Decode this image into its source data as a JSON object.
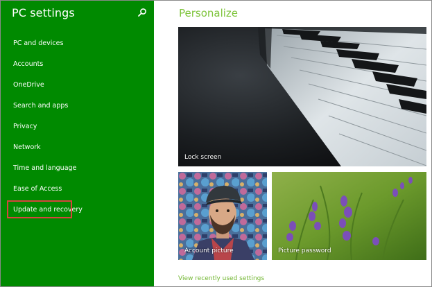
{
  "sidebar": {
    "title": "PC settings",
    "search_icon": "search-icon",
    "items": [
      {
        "label": "PC and devices"
      },
      {
        "label": "Accounts"
      },
      {
        "label": "OneDrive"
      },
      {
        "label": "Search and apps"
      },
      {
        "label": "Privacy"
      },
      {
        "label": "Network"
      },
      {
        "label": "Time and language"
      },
      {
        "label": "Ease of Access"
      },
      {
        "label": "Update and recovery",
        "highlighted": true
      }
    ],
    "background_color": "#008a00"
  },
  "main": {
    "title": "Personalize",
    "title_color": "#7ec43b",
    "tiles": {
      "lock_screen": {
        "label": "Lock screen"
      },
      "account_picture": {
        "label": "Account picture"
      },
      "picture_password": {
        "label": "Picture password"
      }
    },
    "recent_link": "View recently used settings"
  },
  "highlight_color": "#d6453d"
}
